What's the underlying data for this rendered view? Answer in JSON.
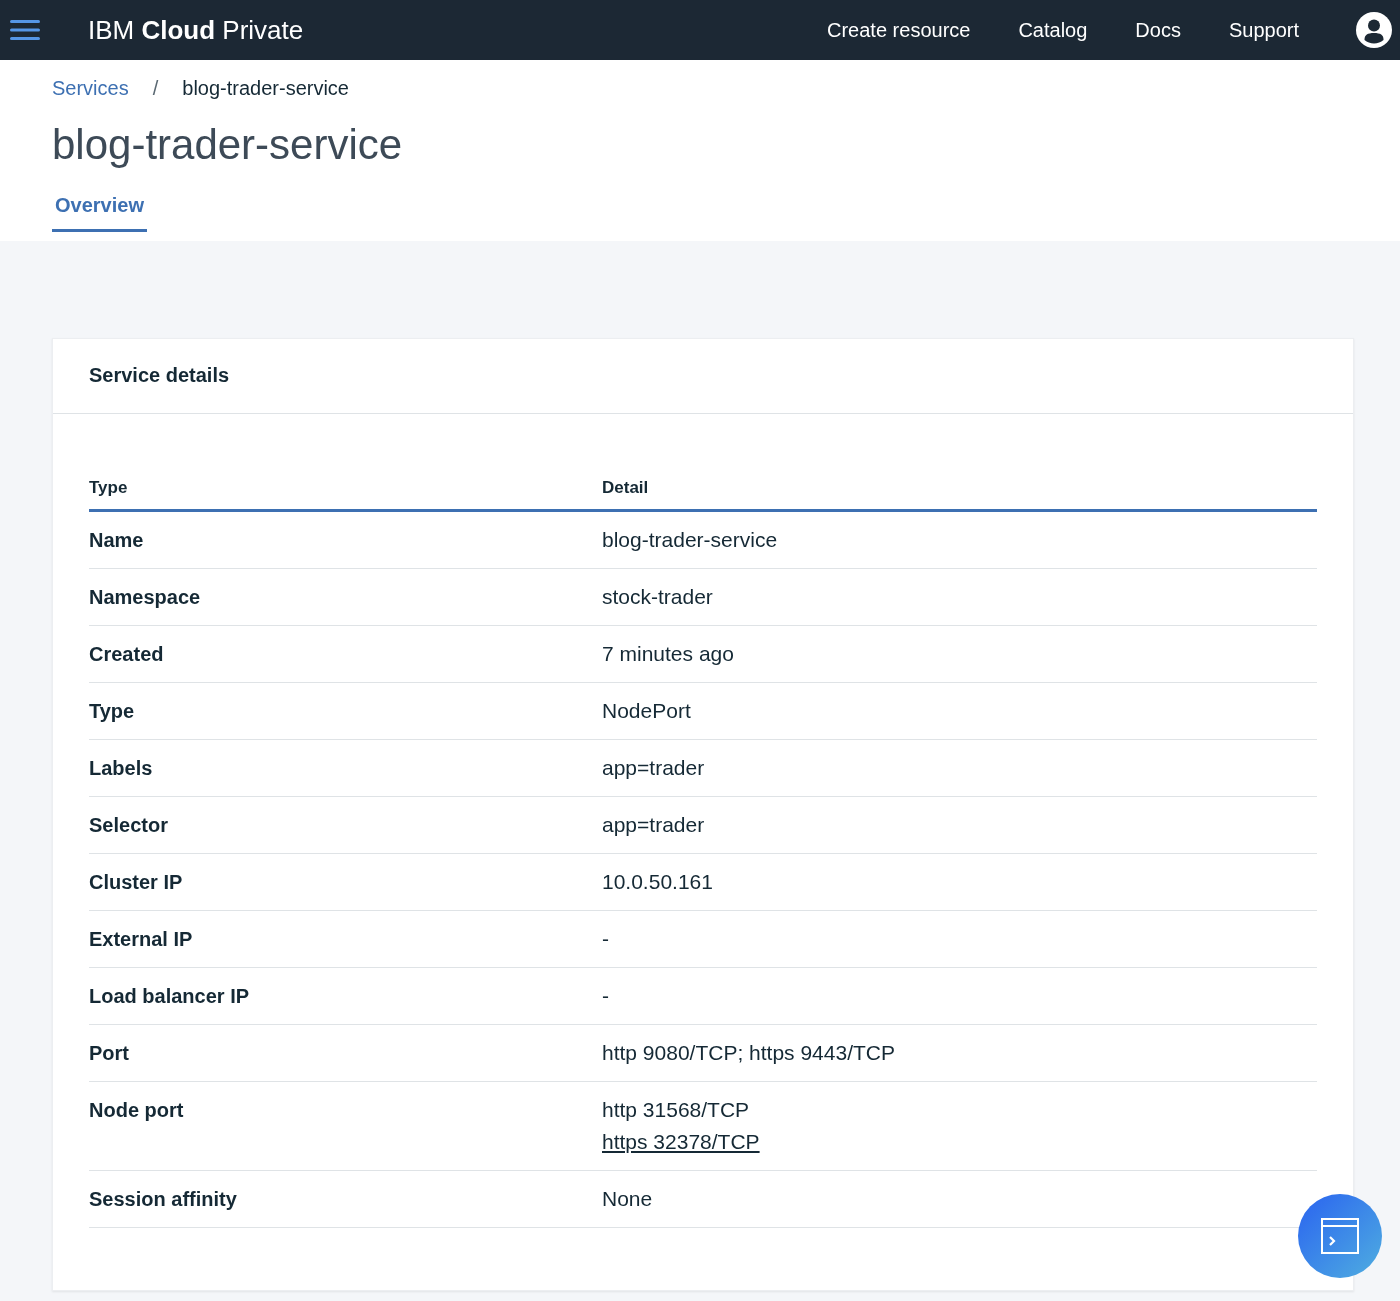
{
  "top_bar": {
    "brand": "IBM **Cloud** Private",
    "nav_links": [
      "Create resource",
      "Catalog",
      "Docs",
      "Support"
    ]
  },
  "breadcrumb": {
    "separator": "/",
    "items": [
      {
        "label": "Services",
        "link": true
      },
      {
        "label": "blog-trader-service",
        "link": false
      }
    ]
  },
  "title": "blog-trader-service",
  "tabs": [
    {
      "label": "Overview",
      "selected": true
    }
  ],
  "card": {
    "title": "Service details",
    "table": {
      "columns": [
        "Type",
        "Detail"
      ],
      "rows": [
        {
          "type": "Name",
          "detail": [
            {
              "text": "blog-trader-service",
              "link": false
            }
          ]
        },
        {
          "type": "Namespace",
          "detail": [
            {
              "text": "stock-trader",
              "link": false
            }
          ]
        },
        {
          "type": "Created",
          "detail": [
            {
              "text": "7 minutes ago",
              "link": false
            }
          ]
        },
        {
          "type": "Type",
          "detail": [
            {
              "text": "NodePort",
              "link": false
            }
          ]
        },
        {
          "type": "Labels",
          "detail": [
            {
              "text": "app=trader",
              "link": false
            }
          ]
        },
        {
          "type": "Selector",
          "detail": [
            {
              "text": "app=trader",
              "link": false
            }
          ]
        },
        {
          "type": "Cluster IP",
          "detail": [
            {
              "text": "10.0.50.161",
              "link": false
            }
          ]
        },
        {
          "type": "External IP",
          "detail": [
            {
              "text": "-",
              "link": false
            }
          ]
        },
        {
          "type": "Load balancer IP",
          "detail": [
            {
              "text": "-",
              "link": false
            }
          ]
        },
        {
          "type": "Port",
          "detail": [
            {
              "text": "http 9080/TCP; https 9443/TCP",
              "link": false
            }
          ]
        },
        {
          "type": "Node port",
          "detail": [
            {
              "text": "http 31568/TCP",
              "link": false
            },
            {
              "text": "https 32378/TCP",
              "link": true
            }
          ]
        },
        {
          "type": "Session affinity",
          "detail": [
            {
              "text": "None",
              "link": false
            }
          ]
        }
      ]
    }
  }
}
